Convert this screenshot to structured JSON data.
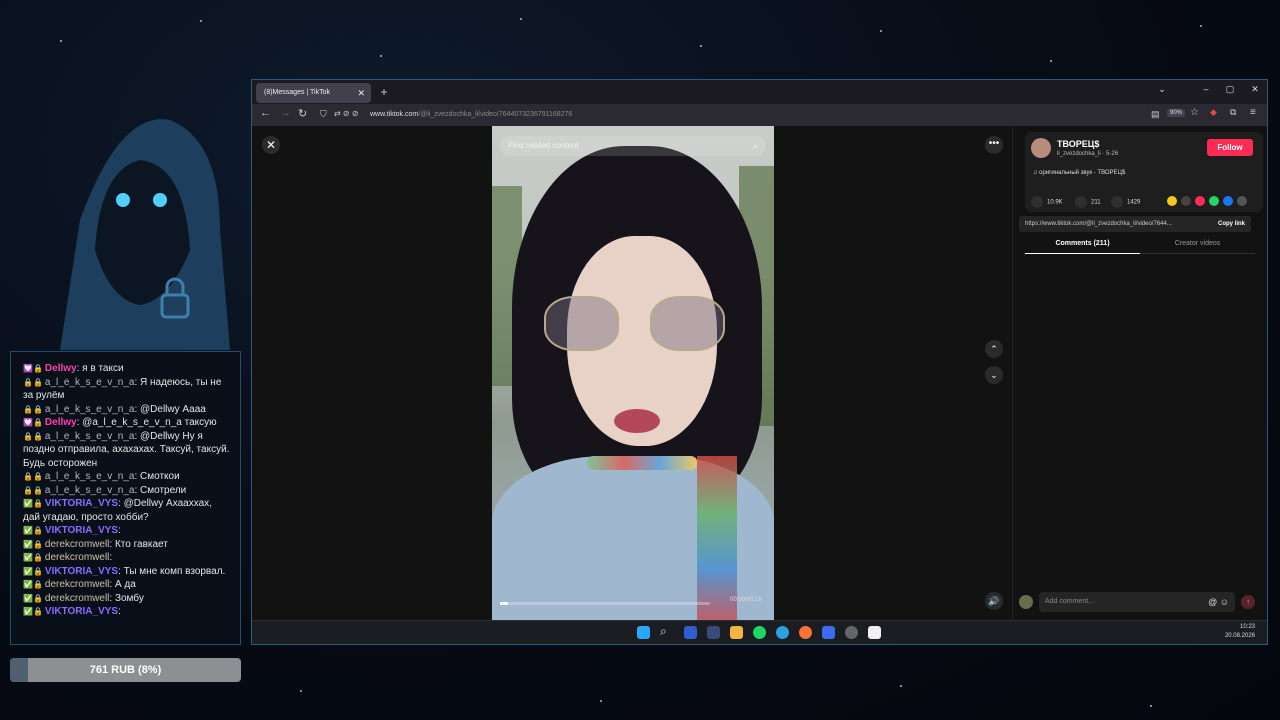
{
  "stream": {
    "chat": [
      {
        "badges": "💟🔒",
        "user": "Dellwy",
        "user_style": "pink",
        "text": ": я в такси"
      },
      {
        "badges": "🔒🔒",
        "user": "a_l_e_k_s_e_v_n_a",
        "user_style": "grey",
        "text": ": Я надеюсь, ты не за рулём"
      },
      {
        "badges": "🔒🔒",
        "user": "a_l_e_k_s_e_v_n_a",
        "user_style": "grey",
        "text": ": @Dellwy Аааа"
      },
      {
        "badges": "💟🔒",
        "user": "Dellwy",
        "user_style": "pink",
        "text": ": @a_l_e_k_s_e_v_n_a таксую"
      },
      {
        "badges": "🔒🔒",
        "user": "a_l_e_k_s_e_v_n_a",
        "user_style": "grey",
        "text": ": @Dellwy Ну я поздно отправила, ахахахах. Таксуй, таксуй. Будь осторожен"
      },
      {
        "badges": "🔒🔒",
        "user": "a_l_e_k_s_e_v_n_a",
        "user_style": "grey",
        "text": ": Смоткои"
      },
      {
        "badges": "🔒🔒",
        "user": "a_l_e_k_s_e_v_n_a",
        "user_style": "grey",
        "text": ": Смотрели"
      },
      {
        "badges": "✅🔒",
        "user": "VIKTORIA_VYS",
        "user_style": "purple",
        "text": ": @Dellwy Ахааххах, дай угадаю, просто хобби?"
      },
      {
        "badges": "✅🔒",
        "user": "VIKTORIA_VYS",
        "user_style": "purple",
        "text": ":"
      },
      {
        "badges": "✅🔒",
        "user": "derekcromwell",
        "user_style": "derek",
        "text": ": Кто гавкает"
      },
      {
        "badges": "✅🔒",
        "user": "derekcromwell",
        "user_style": "derek",
        "text": ":"
      },
      {
        "badges": "✅🔒",
        "user": "VIKTORIA_VYS",
        "user_style": "purple",
        "text": ": Ты мне комп взорвал."
      },
      {
        "badges": "✅🔒",
        "user": "derekcromwell",
        "user_style": "derek",
        "text": ": А да"
      },
      {
        "badges": "✅🔒",
        "user": "derekcromwell",
        "user_style": "derek",
        "text": ": Зомбу"
      },
      {
        "badges": "✅🔒",
        "user": "VIKTORIA_VYS",
        "user_style": "purple",
        "text": ":"
      }
    ],
    "goal": {
      "text": "761 RUB (8%)",
      "fraction": 0.08
    }
  },
  "browser": {
    "tab_title": "(8)Messages | TikTok",
    "url_domain": "www.tiktok.com",
    "url_path": "/@li_zvezdochka_li/video/7644073236791168276",
    "zoom": "90%"
  },
  "video": {
    "search_placeholder": "Find related content",
    "time": "00:00/00:16",
    "progress": 0.04
  },
  "panel": {
    "author_name": "ТВОРЕЦ$",
    "author_sub": "li_zvezdochka_li · 5-26",
    "follow": "Follow",
    "sound": "♫ оригинальный звук - ТВОРЕЦ$",
    "likes": "10.9K",
    "comments_count": "211",
    "saves": "1429",
    "link": "https://www.tiktok.com/@li_zvezdochka_li/video/7644...",
    "copy_link": "Copy link",
    "tab_comments": "Comments (211)",
    "tab_creator": "Creator videos",
    "comment_placeholder": "Add comment..."
  },
  "taskbar": {
    "time": "10:23",
    "date": "20.08.2026"
  },
  "colors": {
    "follow": "#fe2c55",
    "accent_border": "#2b5b7a"
  }
}
